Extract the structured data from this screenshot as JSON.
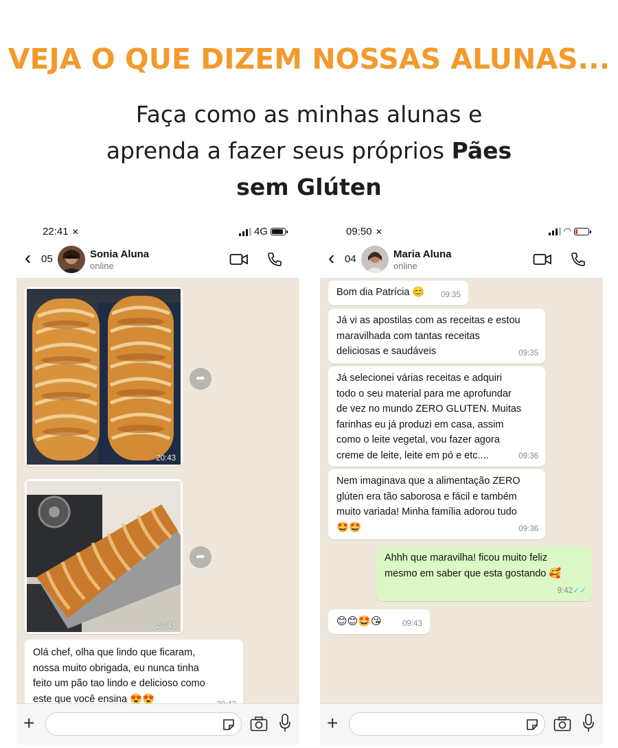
{
  "headline": "VEJA O QUE DIZEM NOSSAS ALUNAS...",
  "subhead": {
    "line1": "Faça como as minhas alunas e",
    "line2_prefix": "aprenda a fazer seus próprios ",
    "line2_bold": "Pães",
    "line3_bold": "sem Glúten"
  },
  "left_phone": {
    "status": {
      "time": "22:41",
      "network": "4G"
    },
    "header": {
      "back_count": "05",
      "name": "Sonia Aluna",
      "status": "online"
    },
    "messages": [
      {
        "type": "image",
        "caption": "bread loaves photo",
        "time": "20:43"
      },
      {
        "type": "image",
        "caption": "bread in baking pan photo",
        "time": "20:43"
      },
      {
        "type": "text",
        "text_1": "Olá chef, olha que lindo que ficaram,",
        "text_2": "nossa muito obrigada, eu nunca tinha",
        "text_3": "feito um pão tao lindo e delicioso como",
        "text_4": "este que você ensina 😍😍",
        "time": "20:43"
      }
    ]
  },
  "right_phone": {
    "status": {
      "time": "09:50"
    },
    "header": {
      "back_count": "04",
      "name": "Maria Aluna",
      "status": "online"
    },
    "messages": [
      {
        "l1": "Bom dia Patrícia 😊",
        "time": "09:35"
      },
      {
        "l1": "Já vi as apostilas com as receitas e estou",
        "l2": "maravilhada com tantas receitas",
        "l3": "deliciosas e saudáveis",
        "time": "09:35"
      },
      {
        "l1": "Já selecionei várias receitas e adquiri",
        "l2": "todo o seu material para me aprofundar",
        "l3": "de vez no mundo ZERO GLUTEN. Muitas",
        "l4": "farinhas eu já produzi em casa, assim",
        "l5": "como o leite vegetal, vou fazer agora",
        "l6": "creme de leite, leite em pó e etc....",
        "time": "09:36"
      },
      {
        "l1": "Nem imaginava que a alimentação ZERO",
        "l2": "glúten era tão saborosa e fácil e também",
        "l3": "muito variada! Minha família adorou tudo",
        "l4": "🤩🤩",
        "time": "09:36"
      },
      {
        "l1": "Ahhh que maravilha! ficou muito feliz",
        "l2": "mesmo em saber que esta gostando 🥰",
        "time": "9:42",
        "out": true
      },
      {
        "l1": "😊😊🤩😘",
        "time": "09:43"
      }
    ]
  },
  "icons": {
    "back": "chevron-left-icon",
    "video": "video-call-icon",
    "call": "phone-icon",
    "plus": "plus-icon",
    "sticker": "sticker-icon",
    "camera": "camera-icon",
    "mic": "microphone-icon",
    "forward": "forward-icon"
  },
  "colors": {
    "headline": "#f39a2c",
    "chat_bg": "#efe7dc",
    "outgoing": "#dcf8c6"
  }
}
